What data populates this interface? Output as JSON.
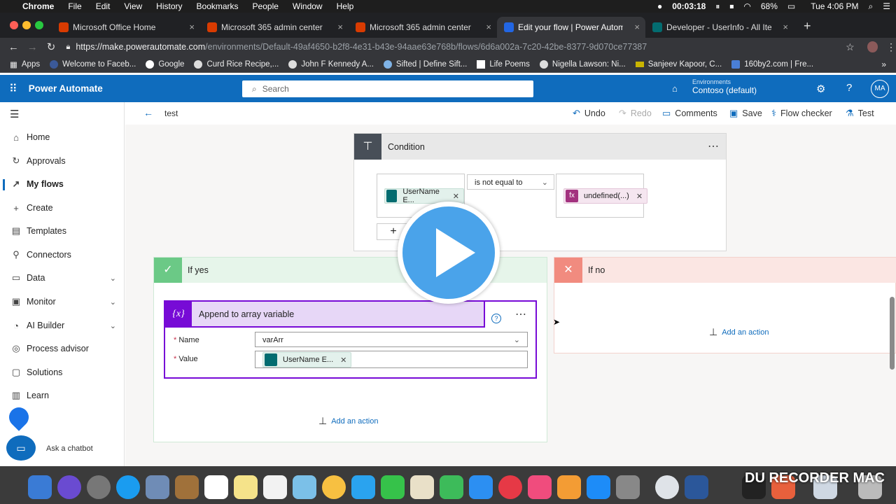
{
  "menubar": {
    "apple": "",
    "app": "Chrome",
    "items": [
      "File",
      "Edit",
      "View",
      "History",
      "Bookmarks",
      "People",
      "Window",
      "Help"
    ],
    "recording_time": "00:03:18",
    "battery": "68%",
    "clock": "Tue 4:06 PM"
  },
  "tabs": [
    {
      "title": "Microsoft Office Home",
      "favicon_color": "#d83b01"
    },
    {
      "title": "Microsoft 365 admin center",
      "favicon_color": "#d83b01"
    },
    {
      "title": "Microsoft 365 admin center",
      "favicon_color": "#d83b01"
    },
    {
      "title": "Edit your flow | Power Automat",
      "favicon_color": "#2266e3"
    },
    {
      "title": "Developer - UserInfo - All Item",
      "favicon_color": "#036c70"
    }
  ],
  "address": {
    "host": "https://make.powerautomate.com",
    "path": "/environments/Default-49af4650-b2f8-4e31-b43e-94aae63e768b/flows/6d6a002a-7c20-42be-8377-9d070ce77387"
  },
  "bookmarks": [
    "Apps",
    "Welcome to Faceb...",
    "Google",
    "Curd Rice Recipe,...",
    "John F Kennedy A...",
    "Sifted | Define Sift...",
    "Life Poems",
    "Nigella Lawson: Ni...",
    "Sanjeev Kapoor, C...",
    "160by2.com | Fre..."
  ],
  "header": {
    "app_name": "Power Automate",
    "search_placeholder": "Search",
    "env_label": "Environments",
    "env_name": "Contoso (default)",
    "avatar": "MA"
  },
  "nav": {
    "items": [
      {
        "label": "Home",
        "icon": "home-icon",
        "glyph": "⌂"
      },
      {
        "label": "Approvals",
        "icon": "approvals-icon",
        "glyph": "↻"
      },
      {
        "label": "My flows",
        "icon": "flows-icon",
        "glyph": "↗"
      },
      {
        "label": "Create",
        "icon": "plus-icon",
        "glyph": "+"
      },
      {
        "label": "Templates",
        "icon": "templates-icon",
        "glyph": "▤"
      },
      {
        "label": "Connectors",
        "icon": "connectors-icon",
        "glyph": "⚲"
      },
      {
        "label": "Data",
        "icon": "data-icon",
        "glyph": "▭"
      },
      {
        "label": "Monitor",
        "icon": "monitor-icon",
        "glyph": "▣"
      },
      {
        "label": "AI Builder",
        "icon": "ai-icon",
        "glyph": "◔"
      },
      {
        "label": "Process advisor",
        "icon": "process-icon",
        "glyph": "◎"
      },
      {
        "label": "Solutions",
        "icon": "solutions-icon",
        "glyph": "▢"
      },
      {
        "label": "Learn",
        "icon": "learn-icon",
        "glyph": "▥"
      }
    ],
    "chatbot_label": "Ask a chatbot"
  },
  "commandbar": {
    "flow_name": "test",
    "undo": "Undo",
    "redo": "Redo",
    "comments": "Comments",
    "save": "Save",
    "flow_checker": "Flow checker",
    "test": "Test"
  },
  "condition": {
    "title": "Condition",
    "left_token": "UserName E...",
    "operator": "is not equal to",
    "right_token": "undefined(...)"
  },
  "if_yes": {
    "title": "If yes",
    "action_title": "Append to array variable",
    "name_label": "Name",
    "name_value": "varArr",
    "value_label": "Value",
    "value_token": "UserName E...",
    "add_action": "Add an action"
  },
  "if_no": {
    "title": "If no",
    "add_action": "Add an action"
  },
  "watermark": "DU RECORDER MAC",
  "colors": {
    "brand": "#0f6cbd",
    "yes_green": "#6bc986",
    "no_red": "#f18b7f",
    "variable_purple": "#770bd6"
  }
}
